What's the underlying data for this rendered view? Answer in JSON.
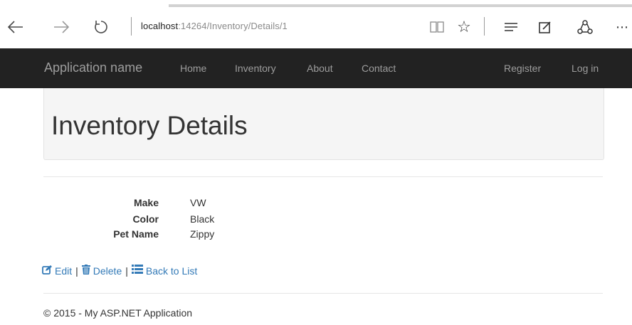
{
  "browser": {
    "address_host": "localhost",
    "address_path": ":14264/Inventory/Details/1",
    "icons": [
      "back-arrow-icon",
      "forward-arrow-icon",
      "refresh-icon",
      "reading-view-icon",
      "favorite-star-icon",
      "hub-icon",
      "web-note-icon",
      "share-icon",
      "more-icon"
    ]
  },
  "navbar": {
    "brand": "Application name",
    "links": [
      "Home",
      "Inventory",
      "About",
      "Contact"
    ],
    "register": "Register",
    "login": "Log in"
  },
  "page": {
    "title": "Inventory Details"
  },
  "details": [
    {
      "label": "Make",
      "value": "VW"
    },
    {
      "label": "Color",
      "value": "Black"
    },
    {
      "label": "Pet Name",
      "value": "Zippy"
    }
  ],
  "actions": {
    "edit": "Edit",
    "delete": "Delete",
    "back": "Back to List",
    "separator": "|"
  },
  "footer": {
    "text": "© 2015 - My ASP.NET Application"
  },
  "colors": {
    "navbar": "#222222",
    "nav_text": "#9d9d9d",
    "link": "#337ab7",
    "jumbotron": "#f5f5f5"
  }
}
